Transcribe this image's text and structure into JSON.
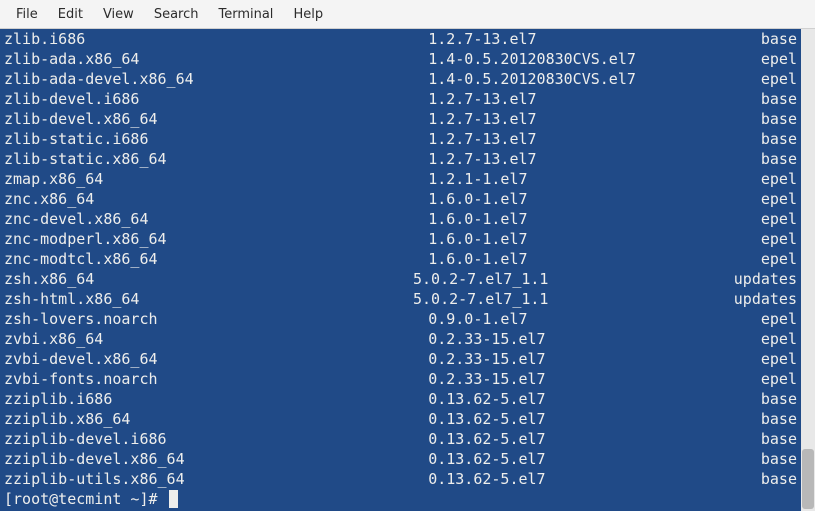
{
  "menubar": {
    "items": [
      "File",
      "Edit",
      "View",
      "Search",
      "Terminal",
      "Help"
    ]
  },
  "packages": [
    {
      "name": "zlib.i686",
      "version": "1.2.7-13.el7",
      "repo": "base"
    },
    {
      "name": "zlib-ada.x86_64",
      "version": "1.4-0.5.20120830CVS.el7",
      "repo": "epel"
    },
    {
      "name": "zlib-ada-devel.x86_64",
      "version": "1.4-0.5.20120830CVS.el7",
      "repo": "epel"
    },
    {
      "name": "zlib-devel.i686",
      "version": "1.2.7-13.el7",
      "repo": "base"
    },
    {
      "name": "zlib-devel.x86_64",
      "version": "1.2.7-13.el7",
      "repo": "base"
    },
    {
      "name": "zlib-static.i686",
      "version": "1.2.7-13.el7",
      "repo": "base"
    },
    {
      "name": "zlib-static.x86_64",
      "version": "1.2.7-13.el7",
      "repo": "base"
    },
    {
      "name": "zmap.x86_64",
      "version": "1.2.1-1.el7",
      "repo": "epel"
    },
    {
      "name": "znc.x86_64",
      "version": "1.6.0-1.el7",
      "repo": "epel"
    },
    {
      "name": "znc-devel.x86_64",
      "version": "1.6.0-1.el7",
      "repo": "epel"
    },
    {
      "name": "znc-modperl.x86_64",
      "version": "1.6.0-1.el7",
      "repo": "epel"
    },
    {
      "name": "znc-modtcl.x86_64",
      "version": "1.6.0-1.el7",
      "repo": "epel"
    },
    {
      "name": "zsh.x86_64",
      "version": "5.0.2-7.el7_1.1",
      "repo": "updates"
    },
    {
      "name": "zsh-html.x86_64",
      "version": "5.0.2-7.el7_1.1",
      "repo": "updates"
    },
    {
      "name": "zsh-lovers.noarch",
      "version": "0.9.0-1.el7",
      "repo": "epel"
    },
    {
      "name": "zvbi.x86_64",
      "version": "0.2.33-15.el7",
      "repo": "epel"
    },
    {
      "name": "zvbi-devel.x86_64",
      "version": "0.2.33-15.el7",
      "repo": "epel"
    },
    {
      "name": "zvbi-fonts.noarch",
      "version": "0.2.33-15.el7",
      "repo": "epel"
    },
    {
      "name": "zziplib.i686",
      "version": "0.13.62-5.el7",
      "repo": "base"
    },
    {
      "name": "zziplib.x86_64",
      "version": "0.13.62-5.el7",
      "repo": "base"
    },
    {
      "name": "zziplib-devel.i686",
      "version": "0.13.62-5.el7",
      "repo": "base"
    },
    {
      "name": "zziplib-devel.x86_64",
      "version": "0.13.62-5.el7",
      "repo": "base"
    },
    {
      "name": "zziplib-utils.x86_64",
      "version": "0.13.62-5.el7",
      "repo": "base"
    }
  ],
  "prompt": "[root@tecmint ~]# "
}
